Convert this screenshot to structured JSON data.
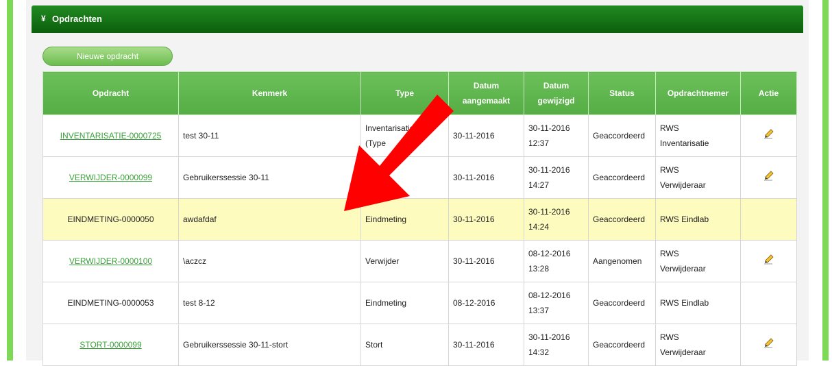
{
  "panel": {
    "chevron": "¥",
    "title": "Opdrachten"
  },
  "new_button_label": "Nieuwe opdracht",
  "columns": [
    "Opdracht",
    "Kenmerk",
    "Type",
    "Datum\naangemaakt",
    "Datum\ngewijzigd",
    "Status",
    "Opdrachtnemer",
    "Actie"
  ],
  "rows": [
    {
      "opdracht": "INVENTARISATIE-0000725",
      "link": true,
      "kenmerk": "test 30-11",
      "type": "Inventarisatie\n(Type",
      "aangemaakt": "30-11-2016",
      "gewijzigd": "30-11-2016\n12:37",
      "status": "Geaccordeerd",
      "opdrachtnemer": "RWS\nInventarisatie",
      "edit": true
    },
    {
      "opdracht": "VERWIJDER-0000099",
      "link": true,
      "kenmerk": "Gebruikerssessie 30-11",
      "type": "",
      "aangemaakt": "30-11-2016",
      "gewijzigd": "30-11-2016\n14:27",
      "status": "Geaccordeerd",
      "opdrachtnemer": "RWS\nVerwijderaar",
      "edit": true
    },
    {
      "opdracht": "EINDMETING-0000050",
      "link": false,
      "highlight": true,
      "kenmerk": "awdafdaf",
      "type": "Eindmeting",
      "aangemaakt": "30-11-2016",
      "gewijzigd": "30-11-2016\n14:24",
      "status": "Geaccordeerd",
      "opdrachtnemer": "RWS Eindlab",
      "edit": false
    },
    {
      "opdracht": "VERWIJDER-0000100",
      "link": true,
      "kenmerk": "\\aczcz",
      "type": "Verwijder",
      "aangemaakt": "30-11-2016",
      "gewijzigd": "08-12-2016\n13:28",
      "status": "Aangenomen",
      "opdrachtnemer": "RWS\nVerwijderaar",
      "edit": true
    },
    {
      "opdracht": "EINDMETING-0000053",
      "link": false,
      "kenmerk": "test 8-12",
      "type": "Eindmeting",
      "aangemaakt": "08-12-2016",
      "gewijzigd": "08-12-2016\n13:37",
      "status": "Geaccordeerd",
      "opdrachtnemer": "RWS Eindlab",
      "edit": false
    },
    {
      "opdracht": "STORT-0000099",
      "link": true,
      "kenmerk": "Gebruikerssessie 30-11-stort",
      "type": "Stort",
      "aangemaakt": "30-11-2016",
      "gewijzigd": "30-11-2016\n14:32",
      "status": "Geaccordeerd",
      "opdrachtnemer": "RWS\nVerwijderaar",
      "edit": true
    }
  ],
  "icons": {
    "edit": "pencil-icon",
    "annotation": "red-arrow-icon"
  },
  "colors": {
    "header_green": "#0c5f0c",
    "table_header": "#5cb44a",
    "highlight": "#fefbbe",
    "arrow": "#ff0000",
    "side_bar": "#7ed957"
  }
}
